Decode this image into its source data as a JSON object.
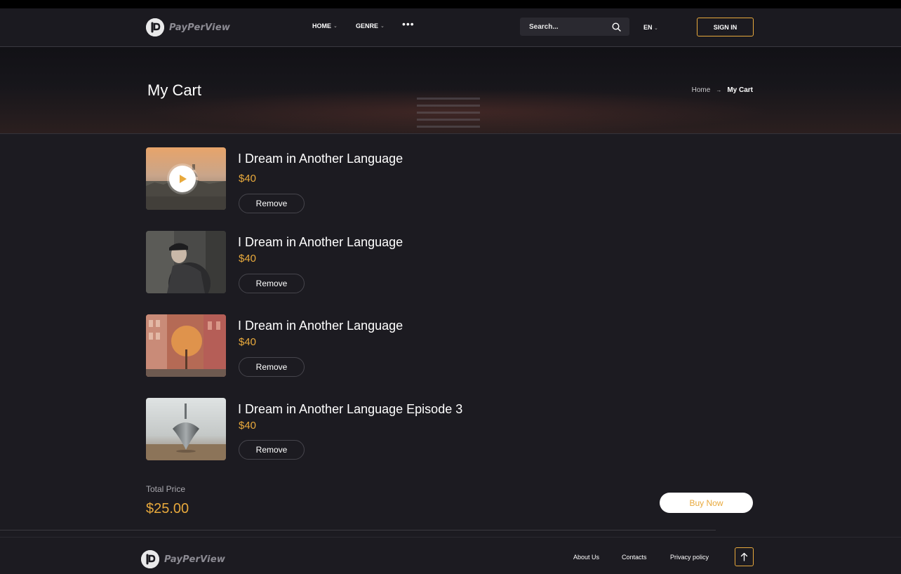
{
  "brand": {
    "name": "PayPerView",
    "logo_letter": "P"
  },
  "header": {
    "nav": [
      {
        "label": "HOME"
      },
      {
        "label": "GENRE"
      }
    ],
    "more_label": "•••",
    "search_placeholder": "Search...",
    "language": "EN",
    "signin_label": "SIGN IN"
  },
  "hero": {
    "title": "My Cart",
    "breadcrumb": {
      "home": "Home",
      "separator": "→",
      "current": "My Cart"
    }
  },
  "cart": {
    "items": [
      {
        "title": "I Dream in Another Language",
        "price": "$40",
        "remove_label": "Remove",
        "thumbnail": "city-sunset-with-play-icon"
      },
      {
        "title": "I Dream in Another Language",
        "price": "$40",
        "remove_label": "Remove",
        "thumbnail": "man-in-cap"
      },
      {
        "title": "I Dream in Another Language",
        "price": "$40",
        "remove_label": "Remove",
        "thumbnail": "orange-street"
      },
      {
        "title": "I Dream in Another Language Episode 3",
        "price": "$40",
        "remove_label": "Remove",
        "thumbnail": "spinning-top"
      }
    ],
    "total_label": "Total Price",
    "total_value": "$25.00",
    "buy_label": "Buy Now"
  },
  "footer": {
    "links": [
      {
        "label": "About Us"
      },
      {
        "label": "Contacts"
      },
      {
        "label": "Privacy policy"
      }
    ]
  },
  "colors": {
    "accent": "#e8a93c",
    "background": "#1c1b21",
    "header": "#1b1a20",
    "search_bg": "#2a2930"
  }
}
